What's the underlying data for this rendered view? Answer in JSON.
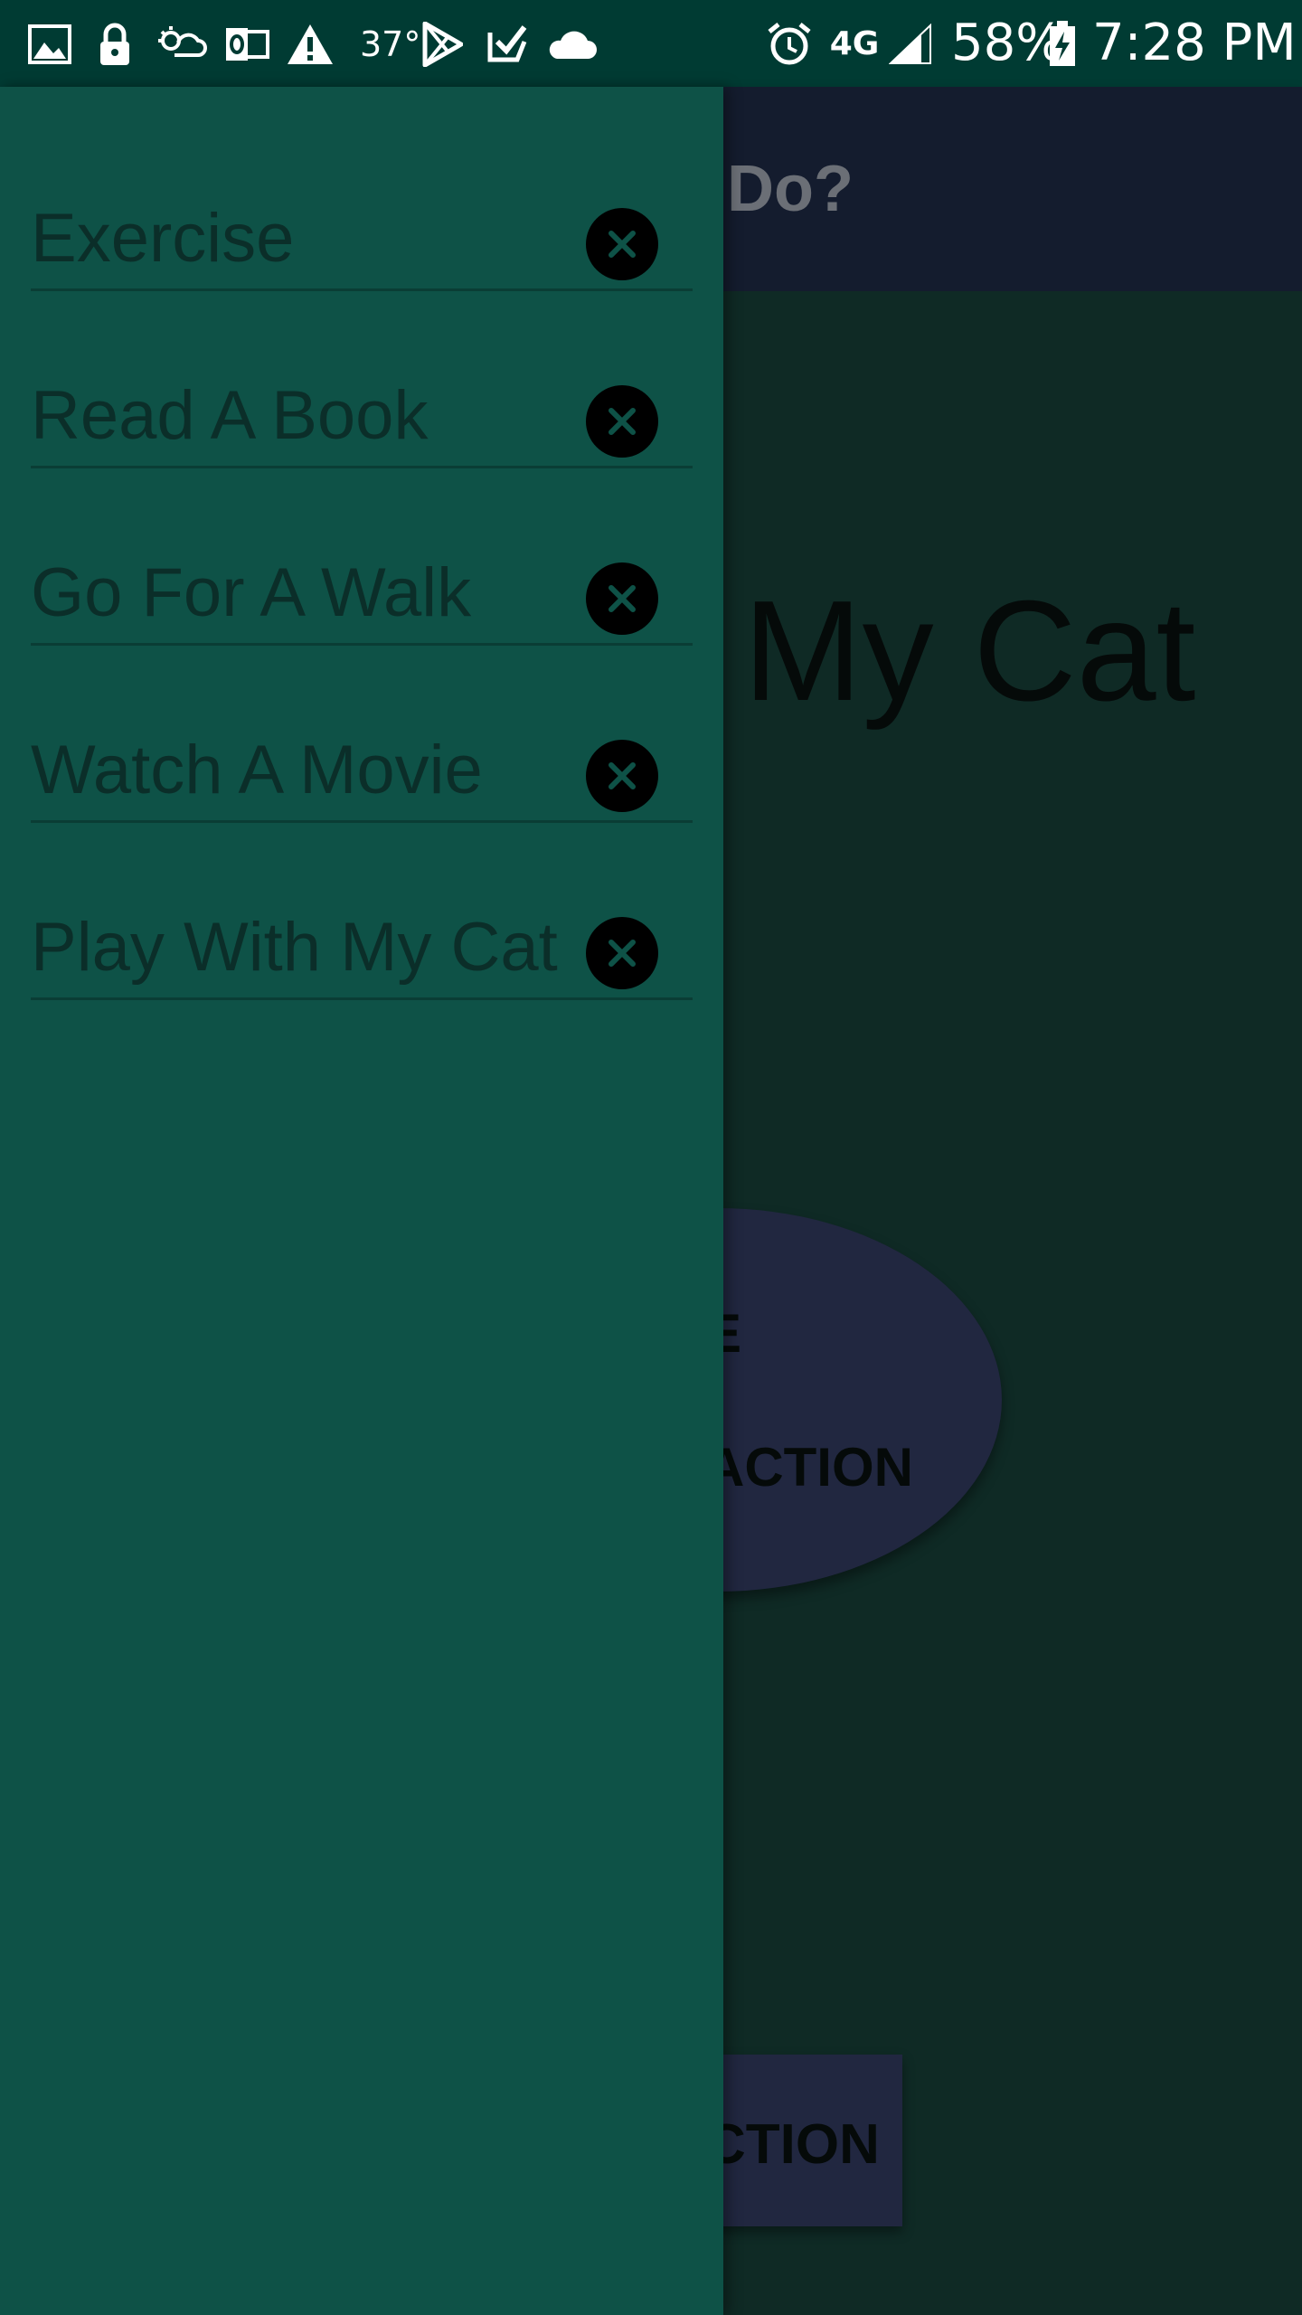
{
  "status_bar": {
    "icons_left": [
      "image-icon",
      "lock-icon",
      "weather-icon",
      "outlook-icon",
      "warning-icon",
      "play-store-icon",
      "check-icon",
      "cloud-icon"
    ],
    "temperature": "37°",
    "icons_right": [
      "alarm-icon",
      "network-4g-icon",
      "signal-icon",
      "battery-charging-icon"
    ],
    "network": "4G",
    "battery": "58%",
    "time": "7:28 PM"
  },
  "app": {
    "title_visible": "Do?",
    "current_activity_visible": "My Cat",
    "oval_button_line1_visible": "E",
    "oval_button_line2_visible": "ACTION",
    "bottom_button_visible": "CTION"
  },
  "drawer": {
    "items": [
      {
        "label": "Exercise"
      },
      {
        "label": "Read A Book"
      },
      {
        "label": "Go For A Walk"
      },
      {
        "label": "Watch A Movie"
      },
      {
        "label": "Play With My Cat"
      }
    ]
  },
  "colors": {
    "status_bar": "#003b33",
    "drawer": "#0e5247",
    "app_bar": "#141c2e",
    "content": "#0f2a25",
    "button": "#212740"
  }
}
